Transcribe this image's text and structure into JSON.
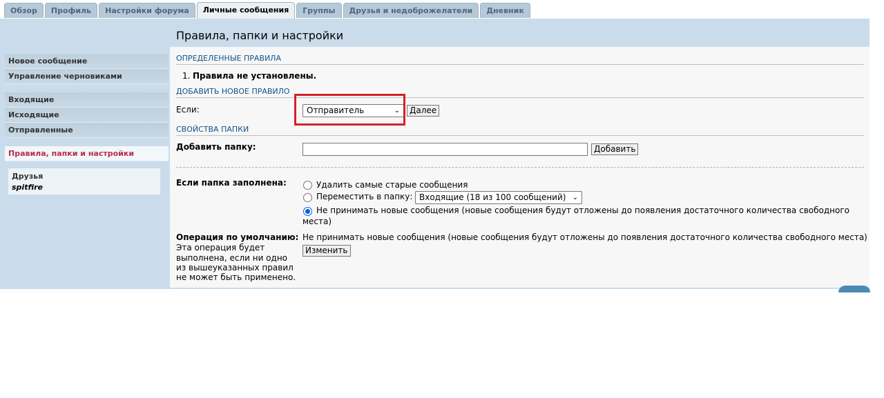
{
  "tabs": [
    "Обзор",
    "Профиль",
    "Настройки форума",
    "Личные сообщения",
    "Группы",
    "Друзья и недоброжелатели",
    "Дневник"
  ],
  "active_tab_index": 3,
  "page_title": "Правила, папки и настройки",
  "sidebar": {
    "group1": [
      "Новое сообщение",
      "Управление черновиками"
    ],
    "group2": [
      "Входящие",
      "Исходящие",
      "Отправленные"
    ],
    "active_item": "Правила, папки и настройки",
    "friends_title": "Друзья",
    "friends_user": "spitfire"
  },
  "rules": {
    "header": "ОПРЕДЕЛЕННЫЕ ПРАВИЛА",
    "item_number": "1.",
    "item_text": "Правила не установлены."
  },
  "new_rule": {
    "header": "ДОБАВИТЬ НОВОЕ ПРАВИЛО",
    "if_label": "Если:",
    "select_value": "Отправитель",
    "next_button": "Далее"
  },
  "folder": {
    "header": "СВОЙСТВА ПАПКИ",
    "add_label": "Добавить папку:",
    "add_value": "",
    "add_button": "Добавить",
    "full_label": "Если папка заполнена:",
    "opt_delete": "Удалить самые старые сообщения",
    "opt_move": "Переместить в папку:",
    "move_select": "Входящие (18 из 100 сообщений)",
    "opt_reject_line1": "Не принимать новые сообщения (новые сообщения будут отложены до появления достаточного количества свободного",
    "opt_reject_line2": "места)",
    "selected_option": "reject",
    "default_label": "Операция по умолчанию:",
    "default_desc": [
      "Эта операция будет",
      "выполнена, если ни одно",
      "из вышеуказанных правил",
      "не может быть применено."
    ],
    "default_value": "Не принимать новые сообщения (новые сообщения будут отложены до появления достаточного количества свободного места)",
    "change_button": "Изменить"
  },
  "colors": {
    "highlight_box": "#d6202a",
    "header_text": "#105289",
    "active_menu": "#bc2a4d"
  }
}
